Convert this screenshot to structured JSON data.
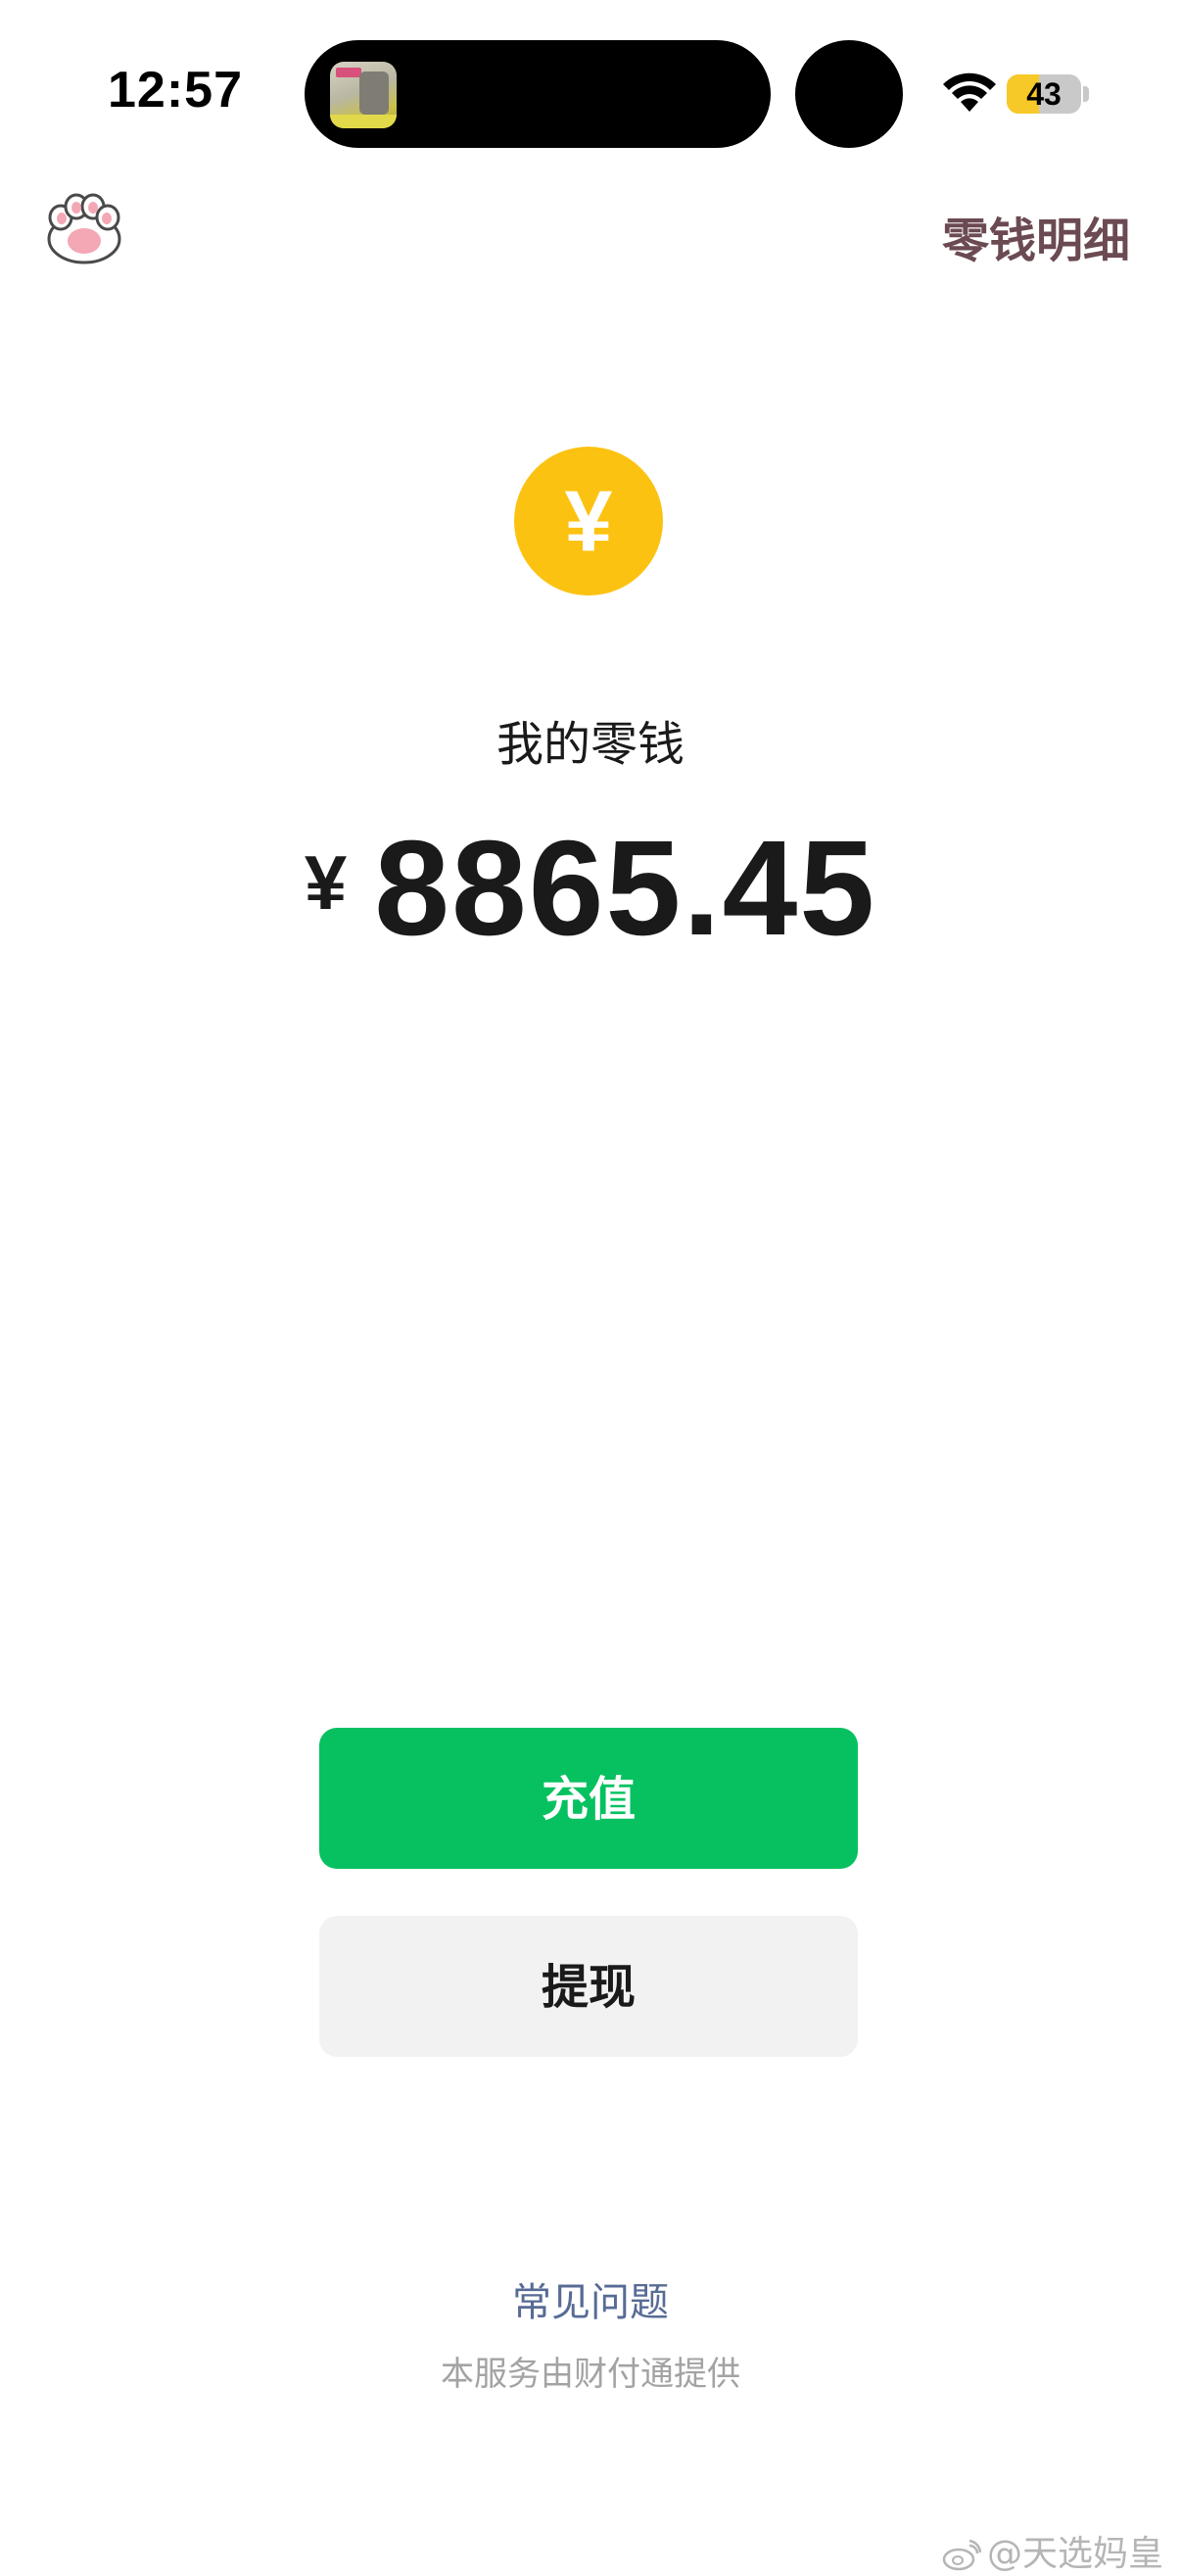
{
  "status_bar": {
    "time": "12:57",
    "battery_level": "43",
    "battery_fraction": 0.43,
    "icons": [
      "now-playing-artwork",
      "wifi-icon",
      "battery-icon"
    ]
  },
  "nav": {
    "back_icon": "cat-paw-icon",
    "detail_link": "零钱明细"
  },
  "balance": {
    "icon": "yuan-coin-icon",
    "coin_symbol": "¥",
    "title": "我的零钱",
    "currency": "¥",
    "amount": "8865.45"
  },
  "actions": {
    "recharge_label": "充值",
    "withdraw_label": "提现"
  },
  "footer": {
    "faq_link": "常见问题",
    "provider_note": "本服务由财付通提供"
  },
  "watermark": {
    "text": "@天选妈皇"
  },
  "colors": {
    "primary_green": "#07c160",
    "coin_yellow": "#fcc211",
    "link_blue": "#576b95",
    "detail_link": "#6b4a52",
    "secondary_button": "#f2f2f2",
    "muted_text": "#a3a3a3"
  }
}
